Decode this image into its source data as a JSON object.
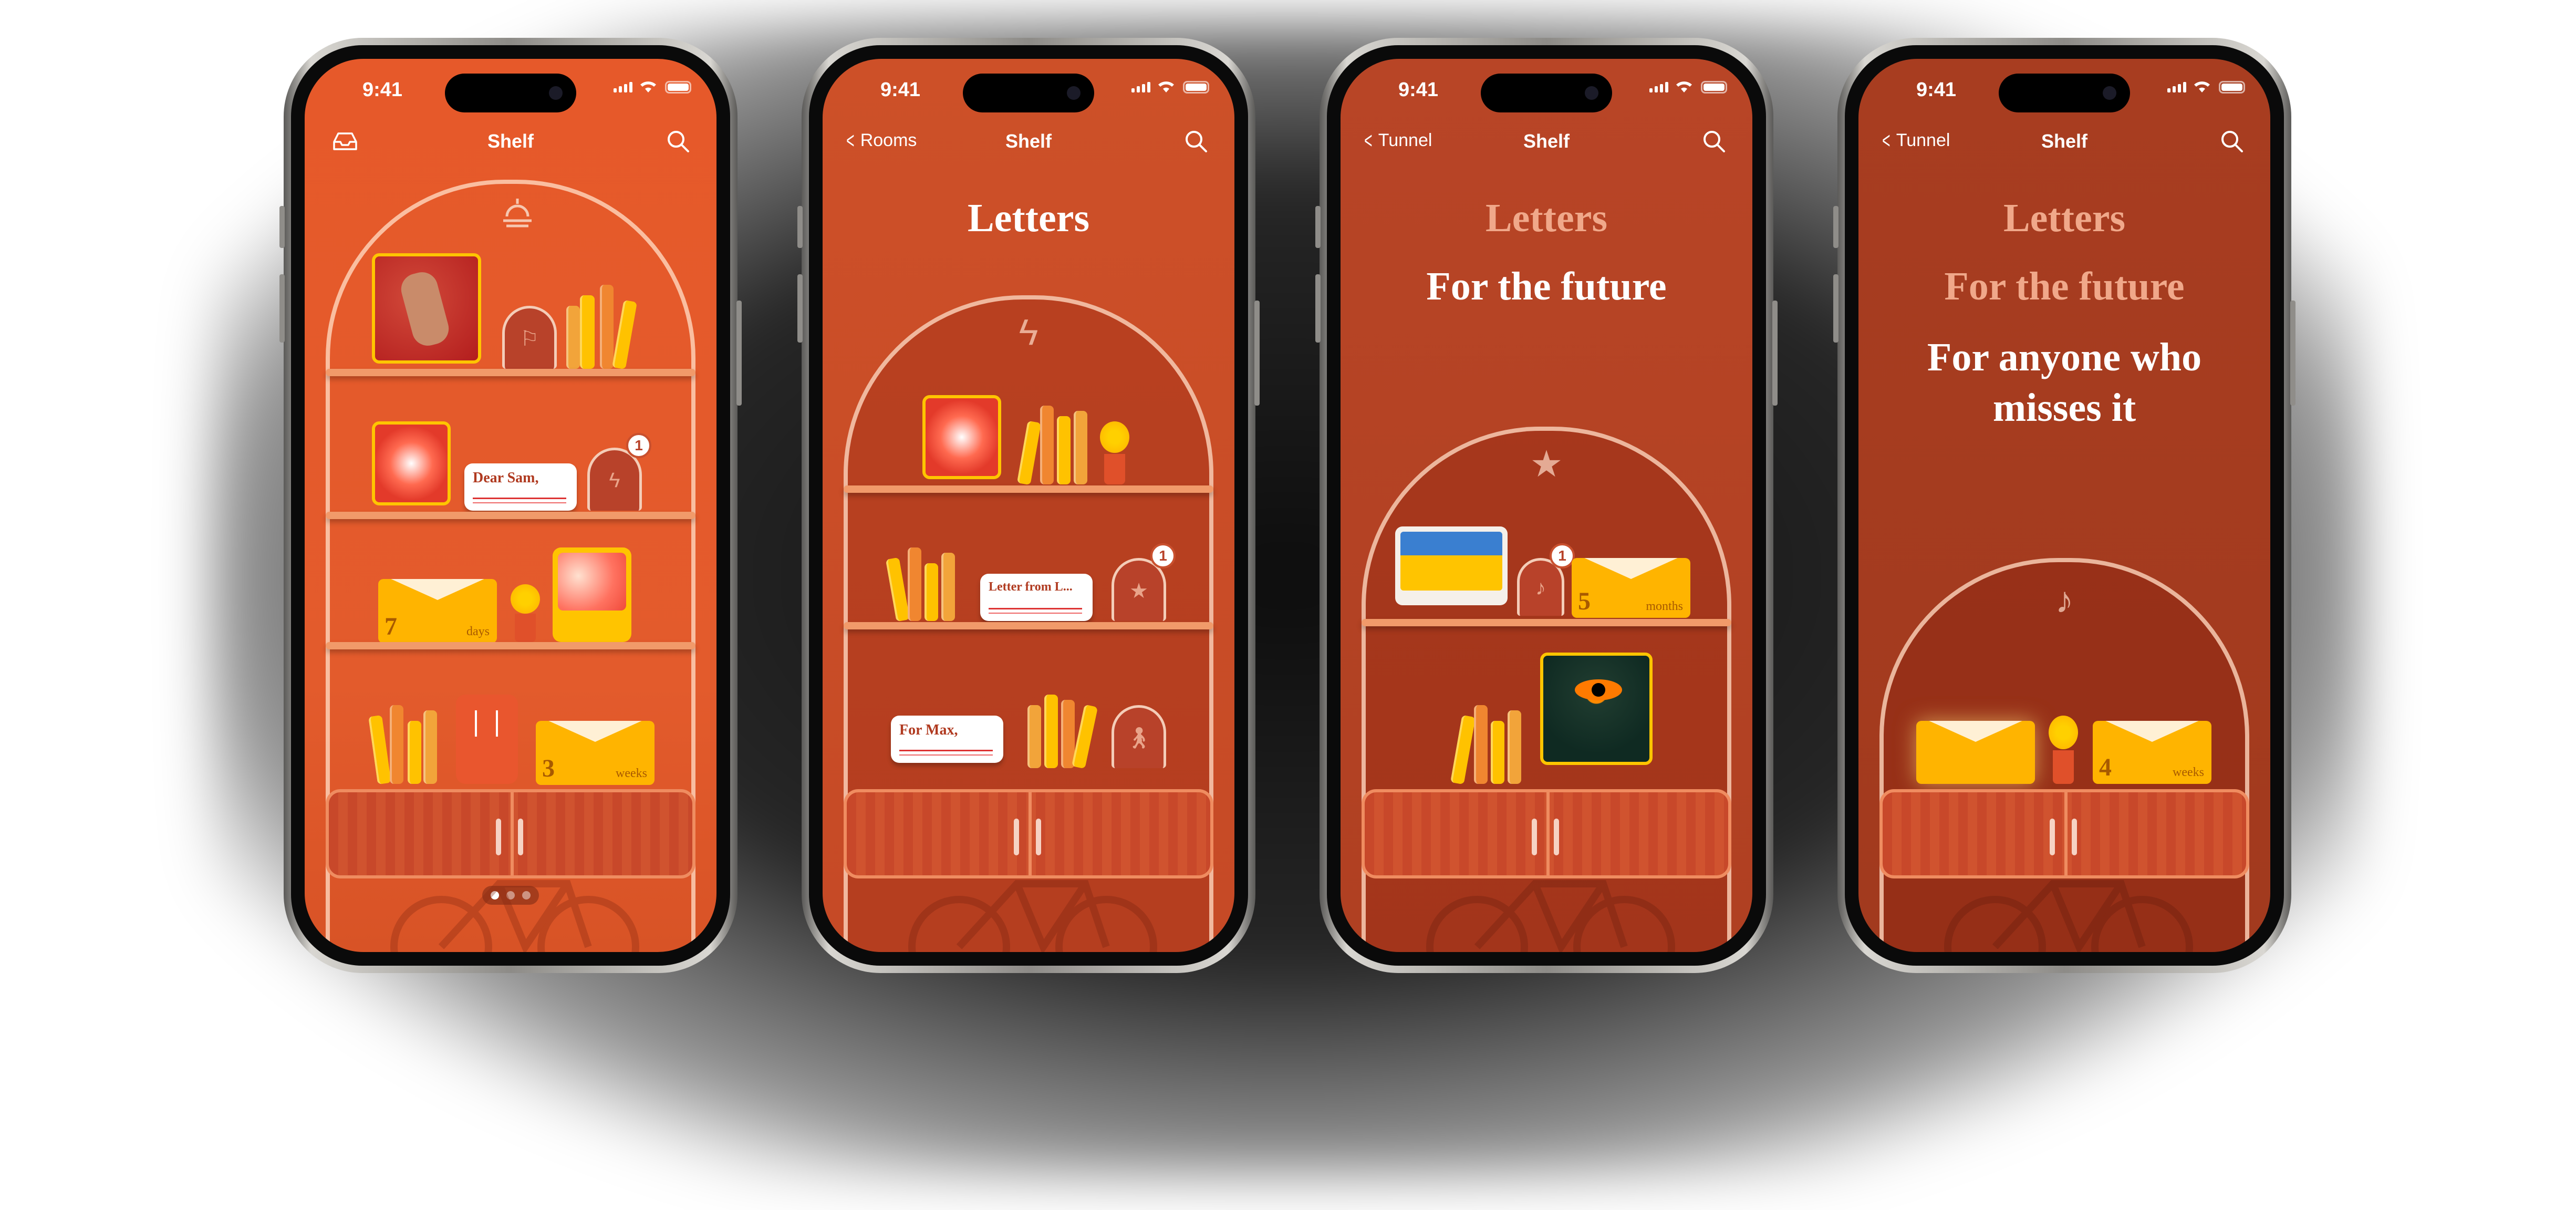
{
  "status_bar": {
    "time": "9:41"
  },
  "screens": [
    {
      "nav_title": "Shelf",
      "nav_back": "",
      "headings": [],
      "letter_card": "Dear Sam,",
      "badge": "1",
      "envelope": {
        "number": "7",
        "unit": "days"
      },
      "envelope2": {
        "number": "3",
        "unit": "weeks"
      }
    },
    {
      "nav_title": "Shelf",
      "nav_back": "Rooms",
      "headings": [
        "Letters"
      ],
      "letter_card": "Letter from L...",
      "letter_card2": "For Max,",
      "badge": "1"
    },
    {
      "nav_title": "Shelf",
      "nav_back": "Tunnel",
      "headings": [
        "Letters",
        "For the future"
      ],
      "badge": "1",
      "envelope": {
        "number": "5",
        "unit": "months"
      }
    },
    {
      "nav_title": "Shelf",
      "nav_back": "Tunnel",
      "headings": [
        "Letters",
        "For the future",
        "For anyone who misses it"
      ],
      "envelope": {
        "number": "4",
        "unit": "weeks"
      }
    }
  ],
  "icons": {
    "screen1_top": "sunrise-icon",
    "screen2_top": "lightning-icon",
    "screen3_top": "star-icon",
    "screen4_top": "music-note-icon"
  },
  "colors": {
    "bg1": "#e35a2b",
    "bg2": "#c8502a",
    "bg3": "#b54424",
    "bg4": "#a63c20",
    "accent": "#ffb400"
  }
}
